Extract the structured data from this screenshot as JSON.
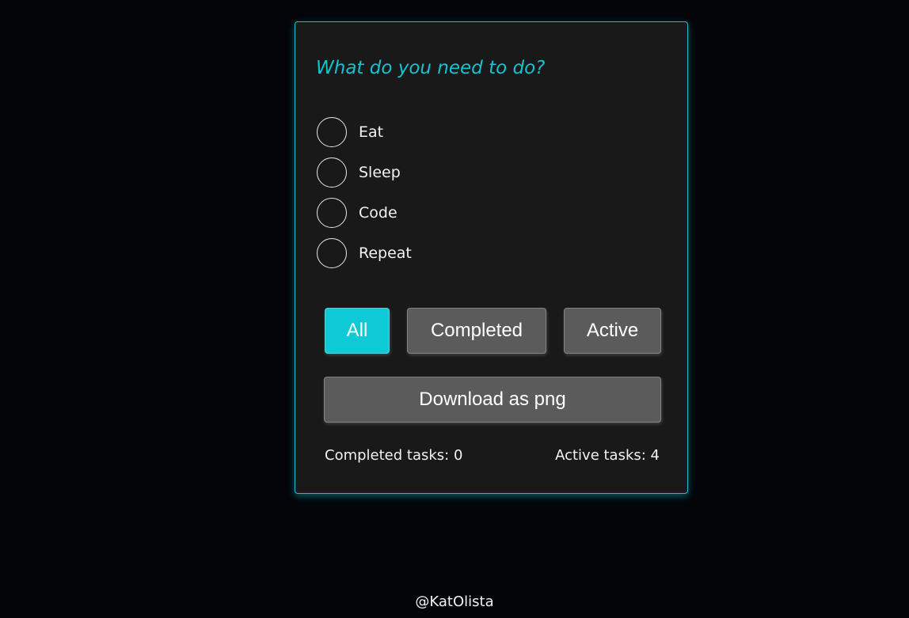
{
  "todo": {
    "input_placeholder": "What do you need to do?",
    "input_value": "",
    "tasks": [
      {
        "label": "Eat",
        "completed": false
      },
      {
        "label": "Sleep",
        "completed": false
      },
      {
        "label": "Code",
        "completed": false
      },
      {
        "label": "Repeat",
        "completed": false
      }
    ],
    "filters": {
      "all_label": "All",
      "completed_label": "Completed",
      "active_label": "Active",
      "selected": "All"
    },
    "download_label": "Download as png",
    "stats": {
      "completed_text": "Completed tasks: 0",
      "active_text": "Active tasks: 4"
    }
  },
  "footer": {
    "credit": "@KatOlista"
  },
  "colors": {
    "accent": "#14c3cf",
    "background": "#030509",
    "card": "#181918",
    "button": "#5c5b5b"
  }
}
